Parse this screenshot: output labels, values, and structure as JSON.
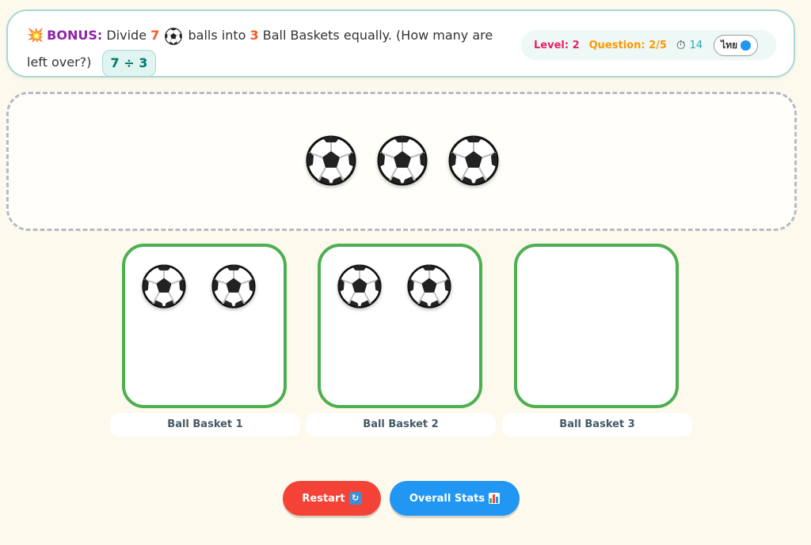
{
  "header": {
    "icon": "collision-icon",
    "bonus_label": "BONUS:",
    "q_part1": "Divide",
    "q_num1": "7",
    "ball_icon": "soccer-ball-icon",
    "q_part2": "balls into",
    "q_num2": "3",
    "q_part3": "Ball Baskets equally. (How many are left over?)",
    "expression": "7 ÷ 3"
  },
  "stats": {
    "level": "Level: 2",
    "question": "Question: 2/5",
    "timer_icon": "stopwatch-icon",
    "timer": "14",
    "lang_label": "ไทย",
    "lang_icon": "globe-icon"
  },
  "pool": {
    "ball_count": 3
  },
  "baskets": [
    {
      "label": "Ball Basket 1",
      "ball_count": 2
    },
    {
      "label": "Ball Basket 2",
      "ball_count": 2
    },
    {
      "label": "Ball Basket 3",
      "ball_count": 0
    }
  ],
  "buttons": {
    "restart": "Restart",
    "restart_icon": "refresh-icon",
    "stats": "Overall Stats",
    "stats_icon": "bar-chart-icon"
  },
  "colors": {
    "basket_border": "#4caf50",
    "bonus": "#8e24aa",
    "highlight_number": "#ff5722",
    "restart": "#f44336",
    "stats": "#2196f3"
  }
}
